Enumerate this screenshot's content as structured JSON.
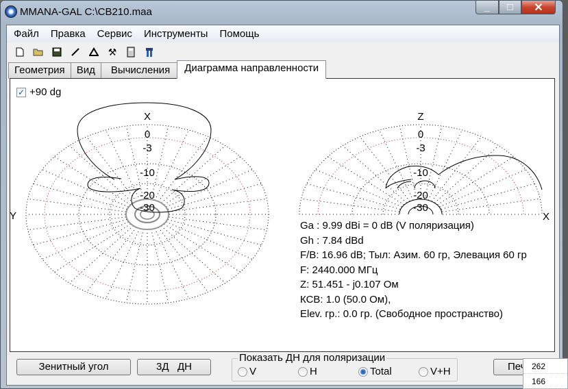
{
  "window": {
    "title": "MMANA-GAL C:\\CB210.maa",
    "minimize": "_",
    "maximize": "□",
    "close": "✕"
  },
  "menu": [
    "Файл",
    "Правка",
    "Сервис",
    "Инструменты",
    "Помощь"
  ],
  "toolbar": [
    "new-file-icon",
    "open-folder-icon",
    "save-icon",
    "line-icon",
    "triangle-icon",
    "tools-icon",
    "calculator-icon",
    "export-icon"
  ],
  "tabs": [
    "Геометрия",
    "Вид",
    "Вычисления",
    "Диаграмма направленности"
  ],
  "checkbox": {
    "label": "+90 dg",
    "checked": true
  },
  "chart_data": [
    {
      "type": "polar",
      "name": "horizontal",
      "axis_top": "X",
      "axis_left": "Y",
      "rings": [
        "0",
        "-3",
        "-10",
        "-20",
        "-30"
      ]
    },
    {
      "type": "polar",
      "name": "vertical",
      "axis_top": "Z",
      "axis_right": "X",
      "rings": [
        "0",
        "-3",
        "-10",
        "-20",
        "-30"
      ]
    }
  ],
  "info": [
    "Ga : 9.99 dBi = 0 dB  (V поляризация)",
    "Gh : 7.84 dBd",
    "F/B: 16.96 dB; Тыл: Азим. 60 гр, Элевация 60 гр",
    "F: 2440.000 МГц",
    "Z: 51.451 - j0.107 Ом",
    "КСВ: 1.0 (50.0 Ом),",
    "Elev. гр.: 0.0 гр. (Свободное пространство)"
  ],
  "buttons": {
    "zenith": "Зенитный угол",
    "3d": "3Д   ДН",
    "print": "Печ"
  },
  "polarization": {
    "title": "Показать ДН для поляризации",
    "options": [
      "V",
      "H",
      "Total",
      "V+H"
    ],
    "selected": "Total"
  },
  "popup": [
    "262",
    "166"
  ]
}
